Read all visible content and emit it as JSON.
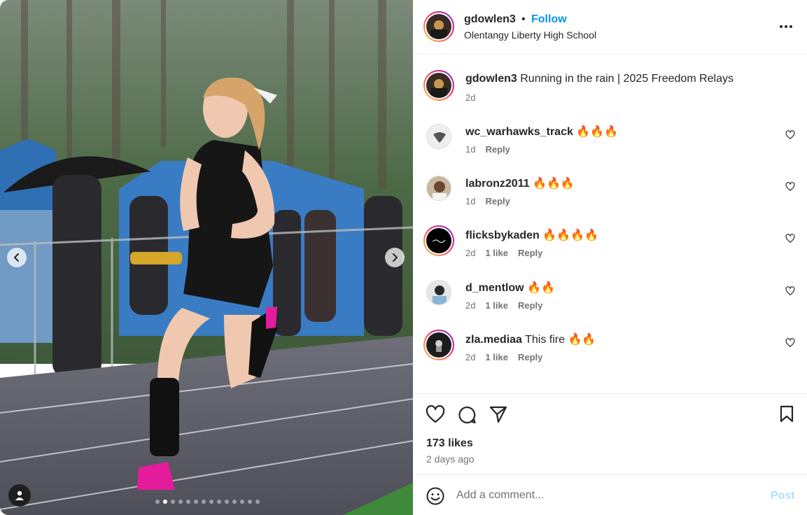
{
  "header": {
    "username": "gdowlen3",
    "separator": "•",
    "follow_label": "Follow",
    "location": "Olentangy Liberty High School",
    "more_icon": "more-horizontal-icon"
  },
  "caption": {
    "username": "gdowlen3",
    "text": "Running in the rain | 2025 Freedom Relays",
    "time": "2d"
  },
  "comments": [
    {
      "username": "wc_warhawks_track",
      "text": "🔥🔥🔥",
      "time": "1d",
      "likes": "",
      "reply": "Reply"
    },
    {
      "username": "labronz2011",
      "text": "🔥🔥🔥",
      "time": "1d",
      "likes": "",
      "reply": "Reply"
    },
    {
      "username": "flicksbykaden",
      "text": "🔥🔥🔥🔥",
      "time": "2d",
      "likes": "1 like",
      "reply": "Reply"
    },
    {
      "username": "d_mentlow",
      "text": "🔥🔥",
      "time": "2d",
      "likes": "1 like",
      "reply": "Reply"
    },
    {
      "username": "zla.mediaa",
      "text": "This fire 🔥🔥",
      "time": "2d",
      "likes": "1 like",
      "reply": "Reply"
    }
  ],
  "post_stats": {
    "likes": "173 likes",
    "posted": "2 days ago"
  },
  "composer": {
    "placeholder": "Add a comment...",
    "post_label": "Post"
  },
  "carousel": {
    "total": 14,
    "active_index": 1
  },
  "colors": {
    "accent": "#0095f6",
    "post_disabled": "#b2dffc",
    "muted": "#737373"
  }
}
